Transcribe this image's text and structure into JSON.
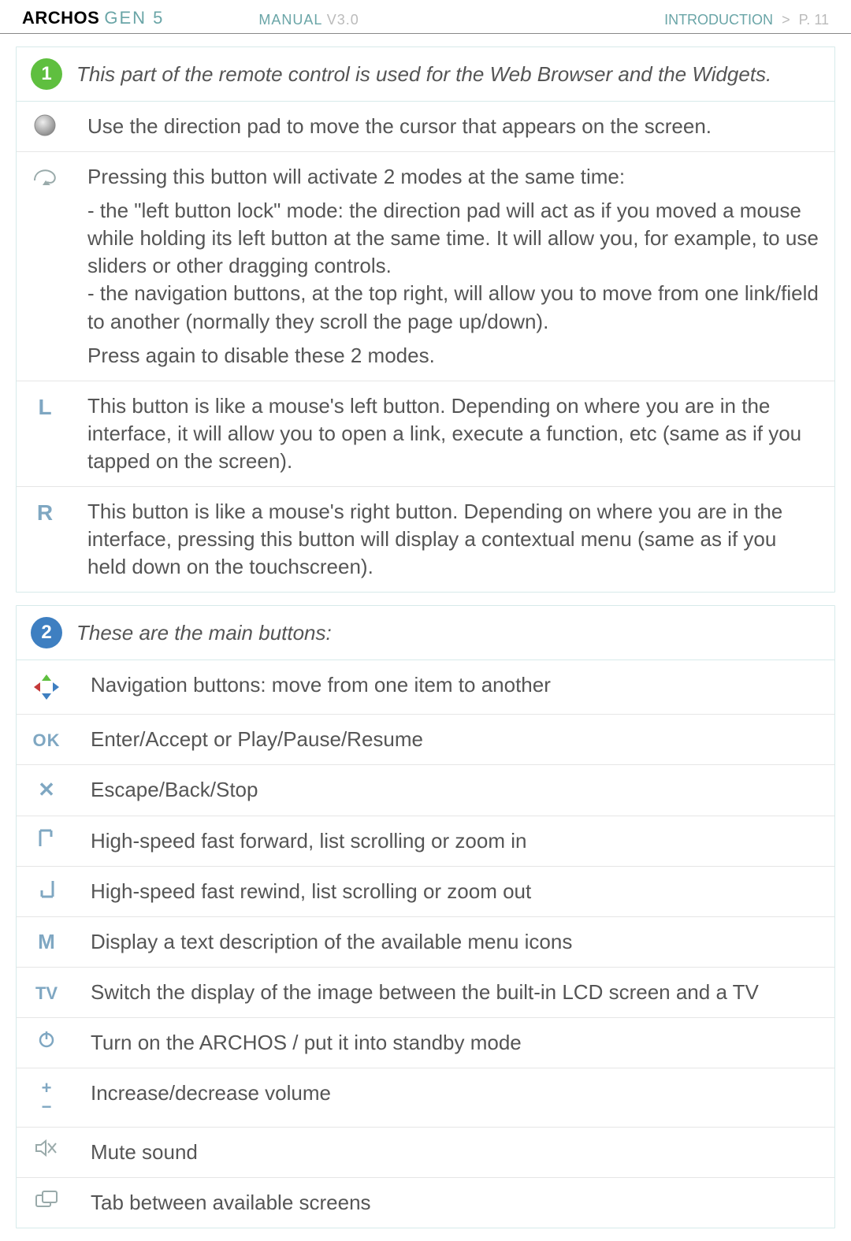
{
  "header": {
    "brand_main": "ARCHOS",
    "brand_gen": "GEN 5",
    "manual": "MANUAL",
    "manual_version": "V3.0",
    "section": "INTRODUCTION",
    "page_prefix": "P.",
    "page_number": "11"
  },
  "panel1": {
    "number": "1",
    "title": "This part of the remote control is used for the Web Browser and the Widgets.",
    "rows": {
      "direction_pad": "Use the direction pad to move the cursor that appears on the screen.",
      "cursor_mode": {
        "lead": "Pressing this button will activate 2 modes at the same time:",
        "bullets": [
          "the \"left button lock\" mode: the direction pad will act as if you moved a mouse while holding its left button at the same time. It will allow you, for example, to use sliders or other dragging controls.",
          "the navigation buttons, at the top right, will allow you to move from one link/field to another (normally they scroll the page up/down)."
        ],
        "tail": "Press again to disable these 2 modes."
      },
      "left_button": {
        "label": "L",
        "text": "This button is like a mouse's left button. Depending on where you are in the interface, it will allow you to open a link, execute a function, etc (same as if you tapped on the screen)."
      },
      "right_button": {
        "label": "R",
        "text": "This button is like a mouse's right button. Depending on where you are in the interface, pressing this button will display a contextual menu (same as if you held down on the touchscreen)."
      }
    }
  },
  "panel2": {
    "number": "2",
    "title": "These are the main buttons:",
    "rows": {
      "nav": "Navigation buttons: move from one item to another",
      "ok": {
        "label": "OK",
        "text": "Enter/Accept or Play/Pause/Resume"
      },
      "x": "Escape/Back/Stop",
      "ff": "High-speed fast forward, list scrolling or zoom in",
      "rw": "High-speed fast rewind, list scrolling or zoom out",
      "m": {
        "label": "M",
        "text": "Display a text description of the available menu icons"
      },
      "tv": {
        "label": "TV",
        "text": "Switch the display of the image between the built-in LCD screen and a TV"
      },
      "power": "Turn on the ARCHOS / put it into standby mode",
      "volume": {
        "plus": "+",
        "minus": "−",
        "text": "Increase/decrease volume"
      },
      "mute": "Mute sound",
      "tab": "Tab between available screens"
    }
  }
}
